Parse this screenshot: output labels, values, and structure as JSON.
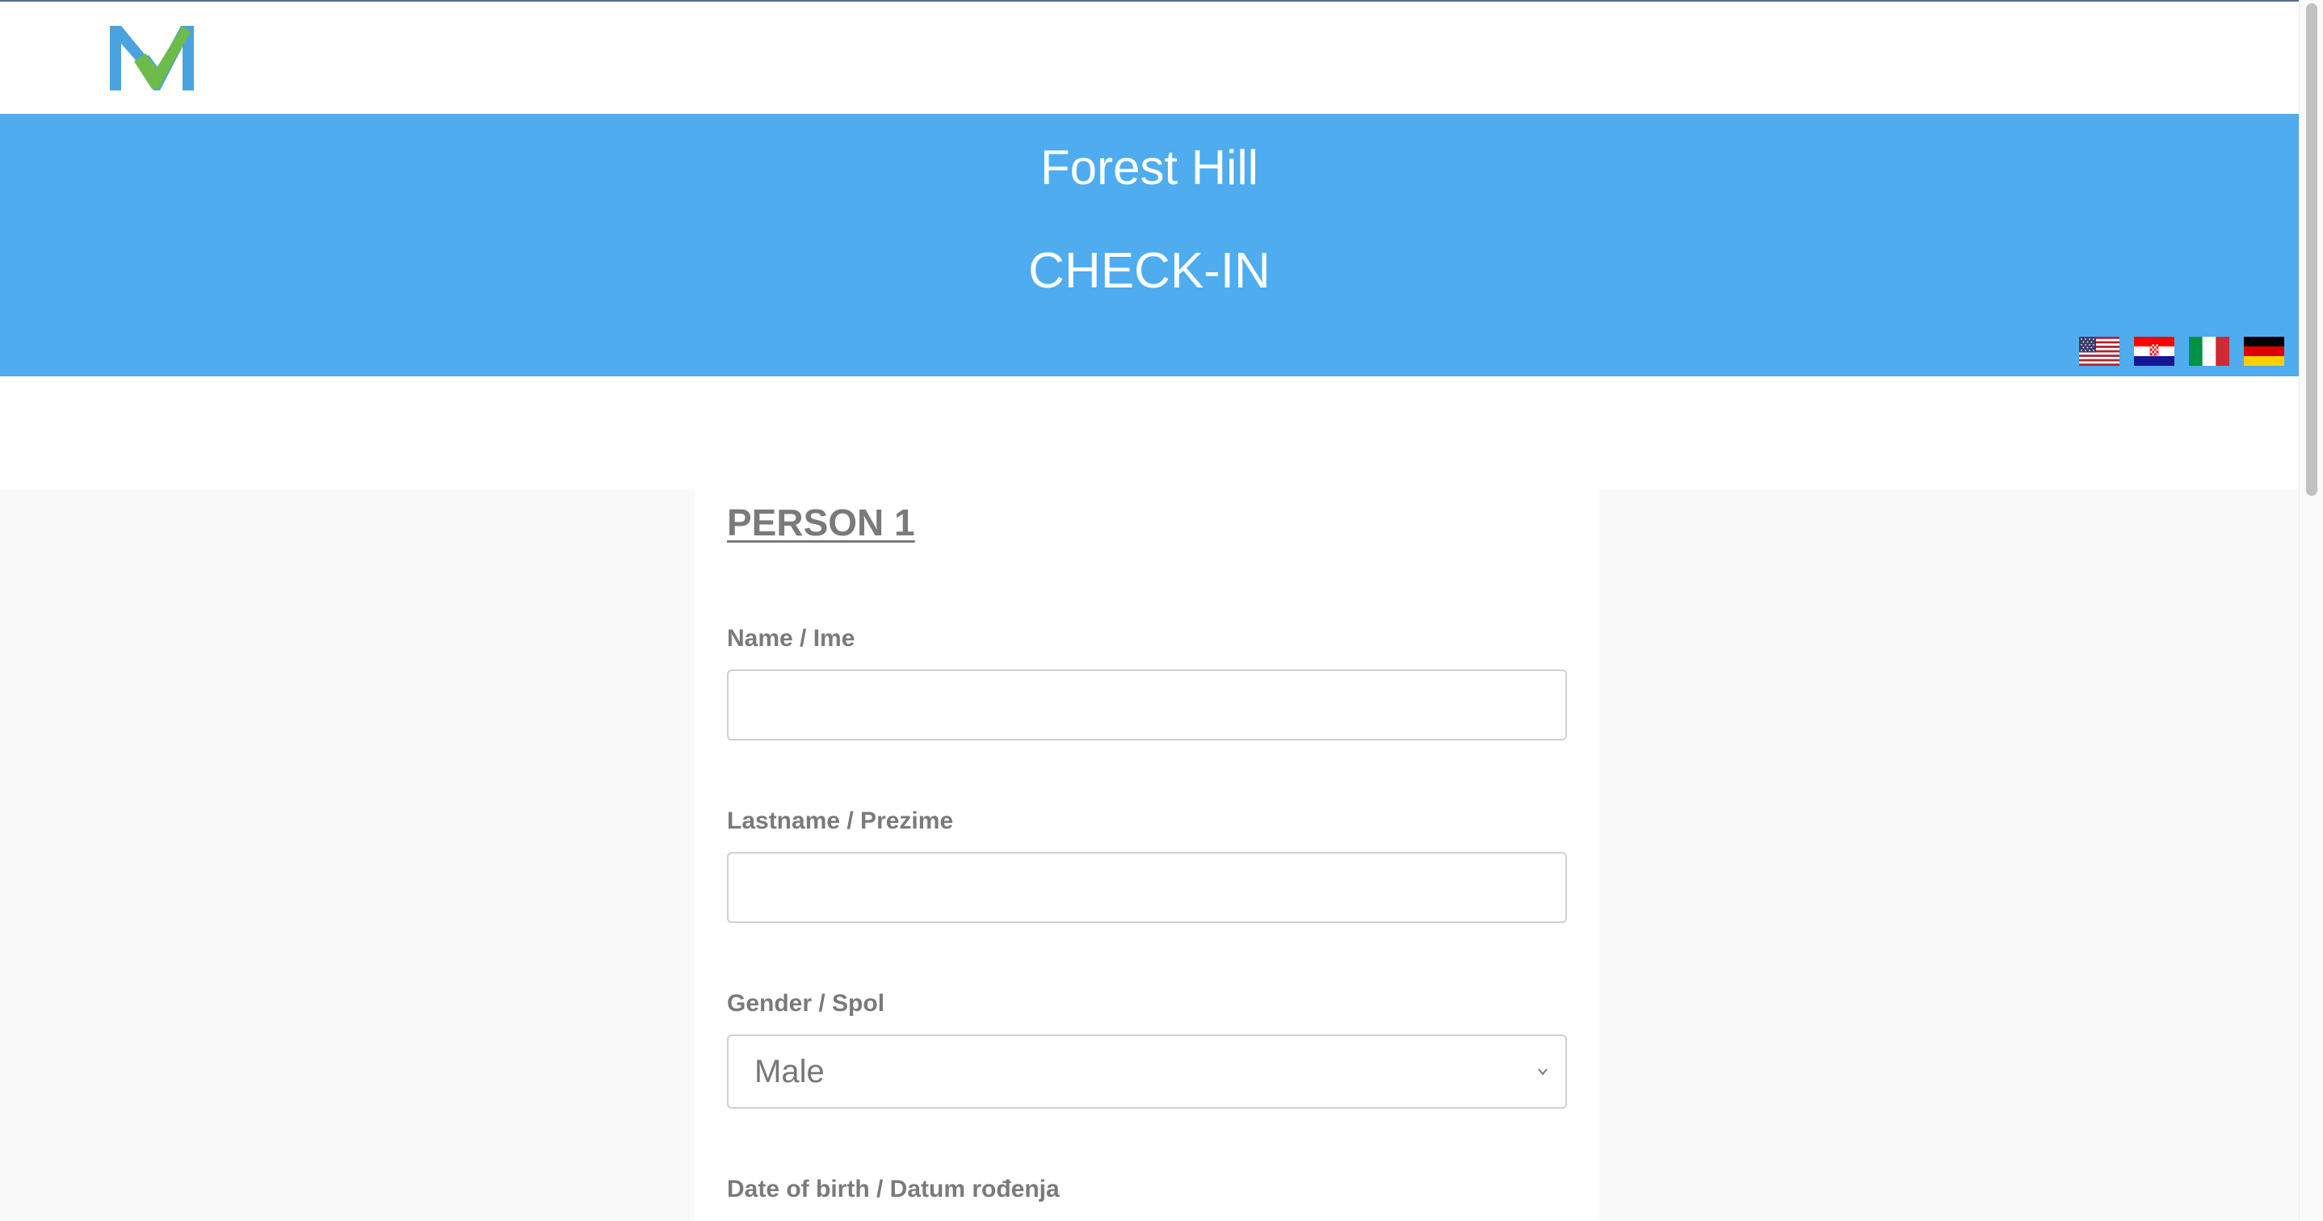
{
  "header": {
    "logo_icon": "m-checkmark-logo",
    "colors": {
      "logo_blue": "#4aa3de",
      "logo_green": "#6cbb4b"
    }
  },
  "banner": {
    "title": "Forest Hill",
    "subtitle": "CHECK-IN",
    "background": "#4eacef",
    "languages": [
      {
        "code": "en",
        "icon": "flag-us-icon"
      },
      {
        "code": "hr",
        "icon": "flag-croatia-icon"
      },
      {
        "code": "it",
        "icon": "flag-italy-icon"
      },
      {
        "code": "de",
        "icon": "flag-germany-icon"
      }
    ]
  },
  "form": {
    "section_title": "PERSON 1",
    "fields": {
      "name": {
        "label": "Name / Ime",
        "value": ""
      },
      "lastname": {
        "label": "Lastname / Prezime",
        "value": ""
      },
      "gender": {
        "label": "Gender / Spol",
        "value": "Male"
      },
      "dob": {
        "label": "Date of birth / Datum rođenja",
        "value": ""
      }
    }
  }
}
